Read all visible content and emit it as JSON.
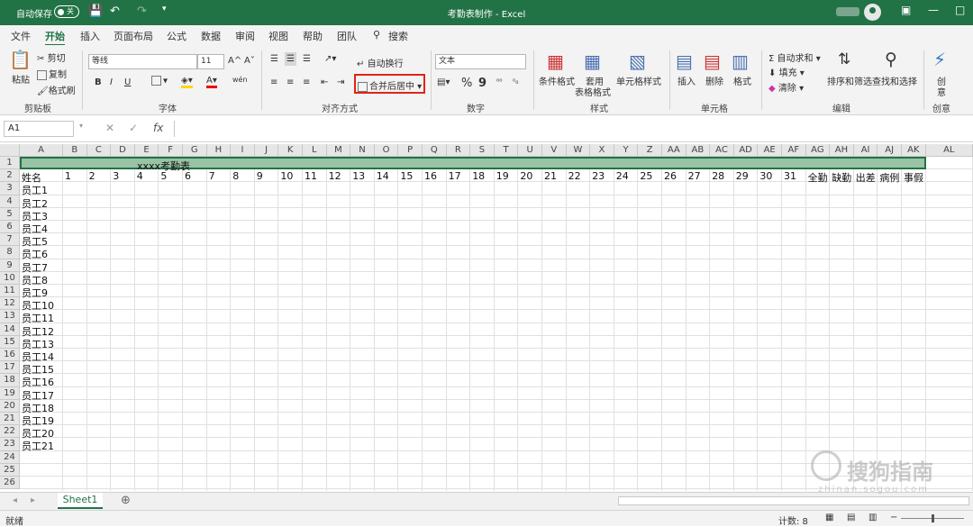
{
  "titlebar": {
    "autosave": "自动保存",
    "toggle": "关",
    "title": "考勤表制作 - Excel"
  },
  "tabs": [
    "文件",
    "开始",
    "插入",
    "页面布局",
    "公式",
    "数据",
    "审阅",
    "视图",
    "帮助",
    "团队"
  ],
  "search": "搜索",
  "clipboard": {
    "paste": "粘贴",
    "cut": "剪切",
    "copy": "复制",
    "painter": "格式刷",
    "label": "剪贴板"
  },
  "font": {
    "name": "等线",
    "size": "11",
    "label": "字体",
    "bold": "B",
    "italic": "I",
    "underline": "U",
    "grow": "A^",
    "shrink": "A˅",
    "color_a": "A",
    "phonetic": "wén"
  },
  "align": {
    "wrap": "自动换行",
    "merge": "合并后居中",
    "label": "对齐方式"
  },
  "number": {
    "format": "文本",
    "label": "数字",
    "percent": "%",
    "comma": "9"
  },
  "styles": {
    "cond": "条件格式",
    "table1": "套用",
    "table2": "表格格式",
    "cell": "单元格样式",
    "label": "样式"
  },
  "cells": {
    "insert": "插入",
    "delete": "删除",
    "format": "格式",
    "label": "单元格"
  },
  "editing": {
    "autosum": "自动求和",
    "fill": "填充",
    "clear": "清除",
    "sort": "排序和筛选",
    "find": "查找和选择",
    "label": "编辑"
  },
  "create": {
    "btn1": "创",
    "btn2": "意",
    "label": "创意"
  },
  "namebox": "A1",
  "fx": "fx",
  "columns": [
    "A",
    "B",
    "C",
    "D",
    "E",
    "F",
    "G",
    "H",
    "I",
    "J",
    "K",
    "L",
    "M",
    "N",
    "O",
    "P",
    "Q",
    "R",
    "S",
    "T",
    "U",
    "V",
    "W",
    "X",
    "Y",
    "Z",
    "AA",
    "AB",
    "AC",
    "AD",
    "AE",
    "AF",
    "AG",
    "AH",
    "AI",
    "AJ",
    "AK",
    "AL"
  ],
  "rows": [
    "1",
    "2",
    "3",
    "4",
    "5",
    "6",
    "7",
    "8",
    "9",
    "10",
    "11",
    "12",
    "13",
    "14",
    "15",
    "16",
    "17",
    "18",
    "19",
    "20",
    "21",
    "22",
    "23",
    "24",
    "25",
    "26"
  ],
  "sheet": {
    "title": "xxxx考勤表",
    "header": [
      "姓名",
      "1",
      "2",
      "3",
      "4",
      "5",
      "6",
      "7",
      "8",
      "9",
      "10",
      "11",
      "12",
      "13",
      "14",
      "15",
      "16",
      "17",
      "18",
      "19",
      "20",
      "21",
      "22",
      "23",
      "24",
      "25",
      "26",
      "27",
      "28",
      "29",
      "30",
      "31",
      "全勤",
      "缺勤",
      "出差",
      "病例",
      "事假"
    ],
    "names": [
      "员工1",
      "员工2",
      "员工3",
      "员工4",
      "员工5",
      "员工6",
      "员工7",
      "员工8",
      "员工9",
      "员工10",
      "员工11",
      "员工12",
      "员工13",
      "员工14",
      "员工15",
      "员工16",
      "员工17",
      "员工18",
      "员工19",
      "员工20",
      "员工21"
    ]
  },
  "sheettab": "Sheet1",
  "status": {
    "ready": "就绪",
    "count": "计数: 8"
  },
  "watermark": {
    "text": "搜狗指南",
    "sub": "zhinan.sogou.com"
  }
}
